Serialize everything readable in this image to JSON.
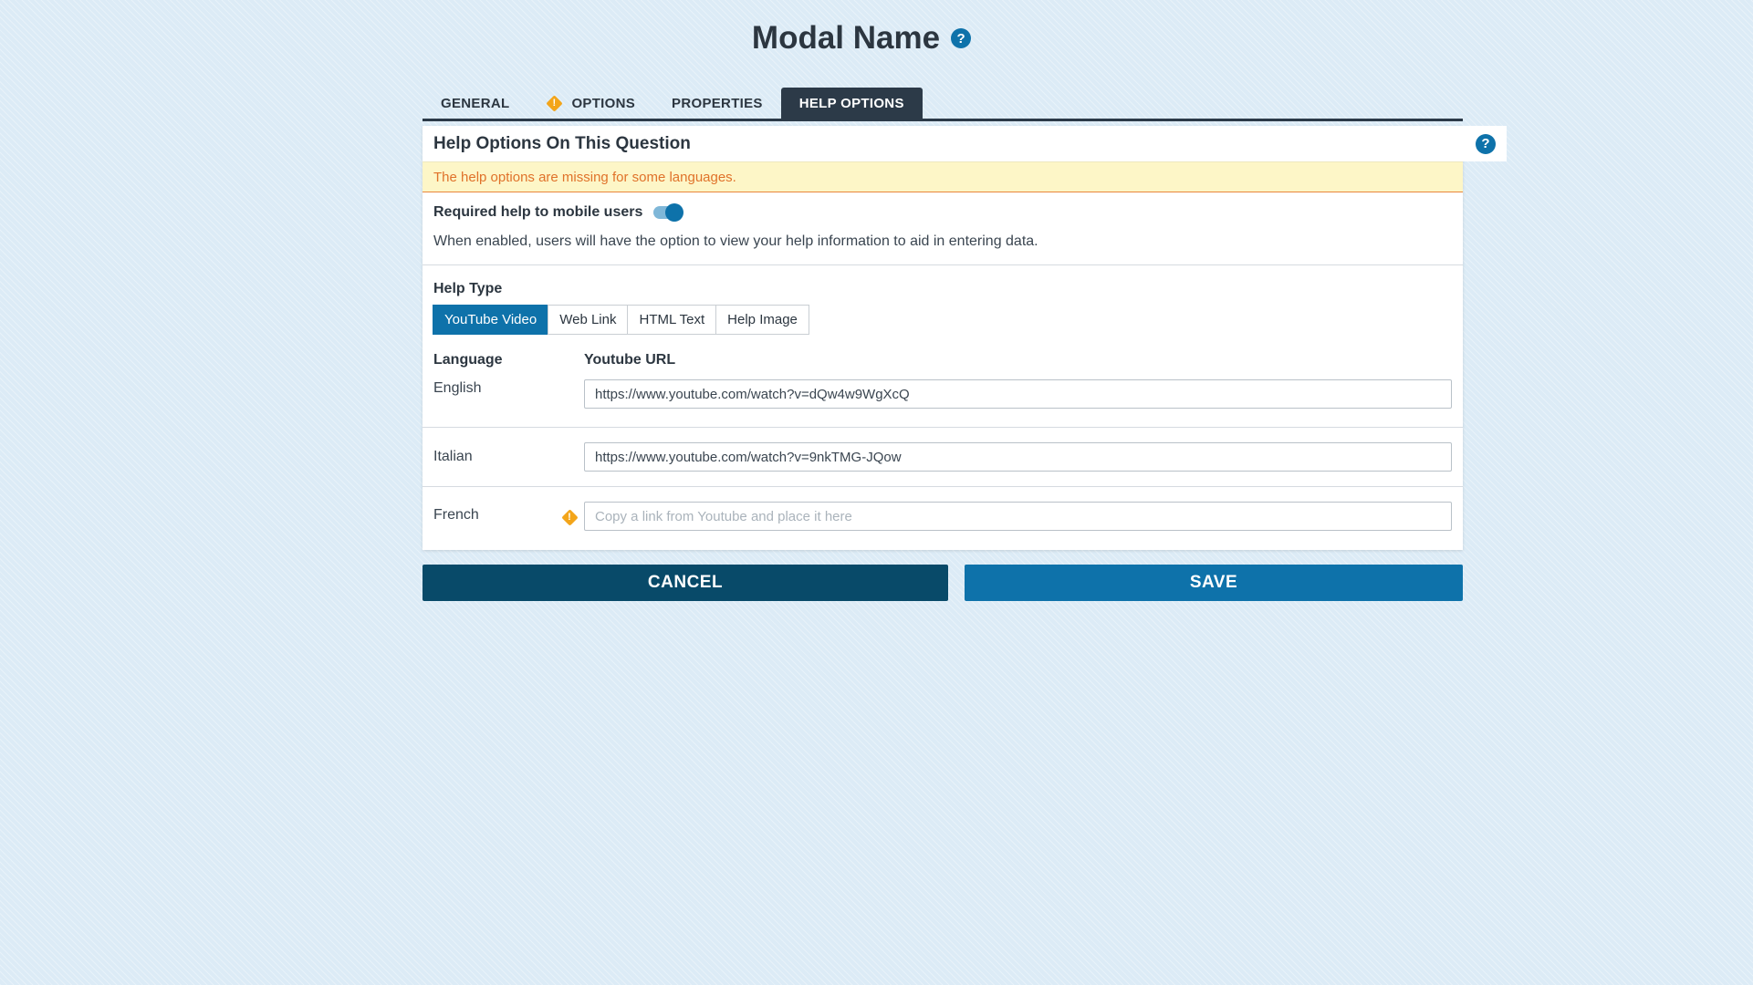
{
  "header": {
    "title": "Modal Name",
    "help_icon": "?"
  },
  "tabs": [
    {
      "label": "GENERAL",
      "active": false,
      "warning": false
    },
    {
      "label": "OPTIONS",
      "active": false,
      "warning": true
    },
    {
      "label": "PROPERTIES",
      "active": false,
      "warning": false
    },
    {
      "label": "HELP OPTIONS",
      "active": true,
      "warning": false
    }
  ],
  "panel": {
    "title": "Help Options On This Question",
    "help_icon": "?",
    "warning_text": "The help options are missing for some languages.",
    "required_label": "Required help to mobile users",
    "required_enabled": true,
    "required_description": "When enabled, users will have the option to view your help information to aid in entering data.",
    "help_type_label": "Help Type",
    "help_types": [
      "YouTube Video",
      "Web Link",
      "HTML Text",
      "Help Image"
    ],
    "help_type_selected": "YouTube Video",
    "language_header": "Language",
    "url_header": "Youtube URL",
    "languages": [
      {
        "name": "English",
        "url": "https://www.youtube.com/watch?v=dQw4w9WgXcQ",
        "placeholder": "",
        "warning": false
      },
      {
        "name": "Italian",
        "url": "https://www.youtube.com/watch?v=9nkTMG-JQow",
        "placeholder": "",
        "warning": false
      },
      {
        "name": "French",
        "url": "",
        "placeholder": "Copy a link from Youtube and place it here",
        "warning": true
      }
    ]
  },
  "footer": {
    "cancel_label": "CANCEL",
    "save_label": "SAVE"
  },
  "colors": {
    "accent": "#0e72aa",
    "dark": "#2c3a48",
    "cancel": "#084a69",
    "warning": "#f3a51a",
    "warning_text": "#e0722a",
    "warning_bg": "#fdf6c7"
  }
}
